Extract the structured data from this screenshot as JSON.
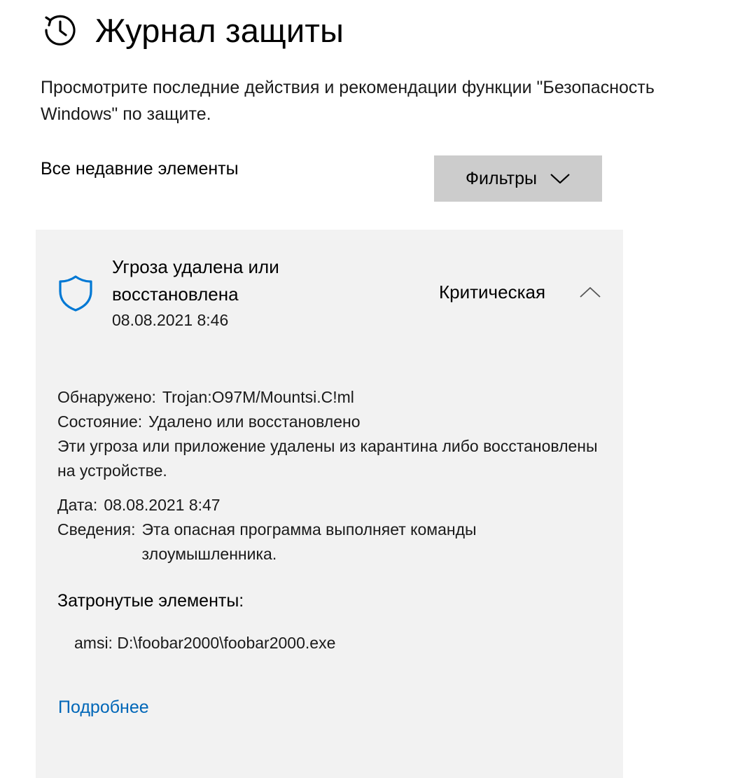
{
  "header": {
    "icon": "history-clock-icon",
    "title": "Журнал защиты"
  },
  "subtitle": "Просмотрите последние действия и рекомендации функции \"Безопасность Windows\" по защите.",
  "list": {
    "section_label": "Все недавние элементы",
    "filters_label": "Фильтры",
    "filters_icon": "chevron-down-icon"
  },
  "threat": {
    "icon": "shield-icon",
    "icon_color": "#0078d4",
    "title": "Угроза удалена или восстановлена",
    "time": "08.08.2021 8:46",
    "severity": "Критическая",
    "expand_icon": "chevron-up-icon",
    "detected_label": "Обнаружено:",
    "detected_value": "Trojan:O97M/Mountsi.C!ml",
    "status_label": "Состояние:",
    "status_value": "Удалено или восстановлено",
    "status_description": "Эти угроза или приложение удалены из карантина либо восстановлены на устройстве.",
    "date_label": "Дата:",
    "date_value": "08.08.2021 8:47",
    "info_label": "Сведения:",
    "info_value": "Эта опасная программа выполняет команды злоумышленника.",
    "affected_title": "Затронутые элементы:",
    "affected_items": [
      "amsi: D:\\foobar2000\\foobar2000.exe"
    ],
    "more_link": "Подробнее",
    "link_color": "#0067b8"
  },
  "colors": {
    "card_background": "#f2f2f2",
    "button_background": "#cccccc"
  }
}
